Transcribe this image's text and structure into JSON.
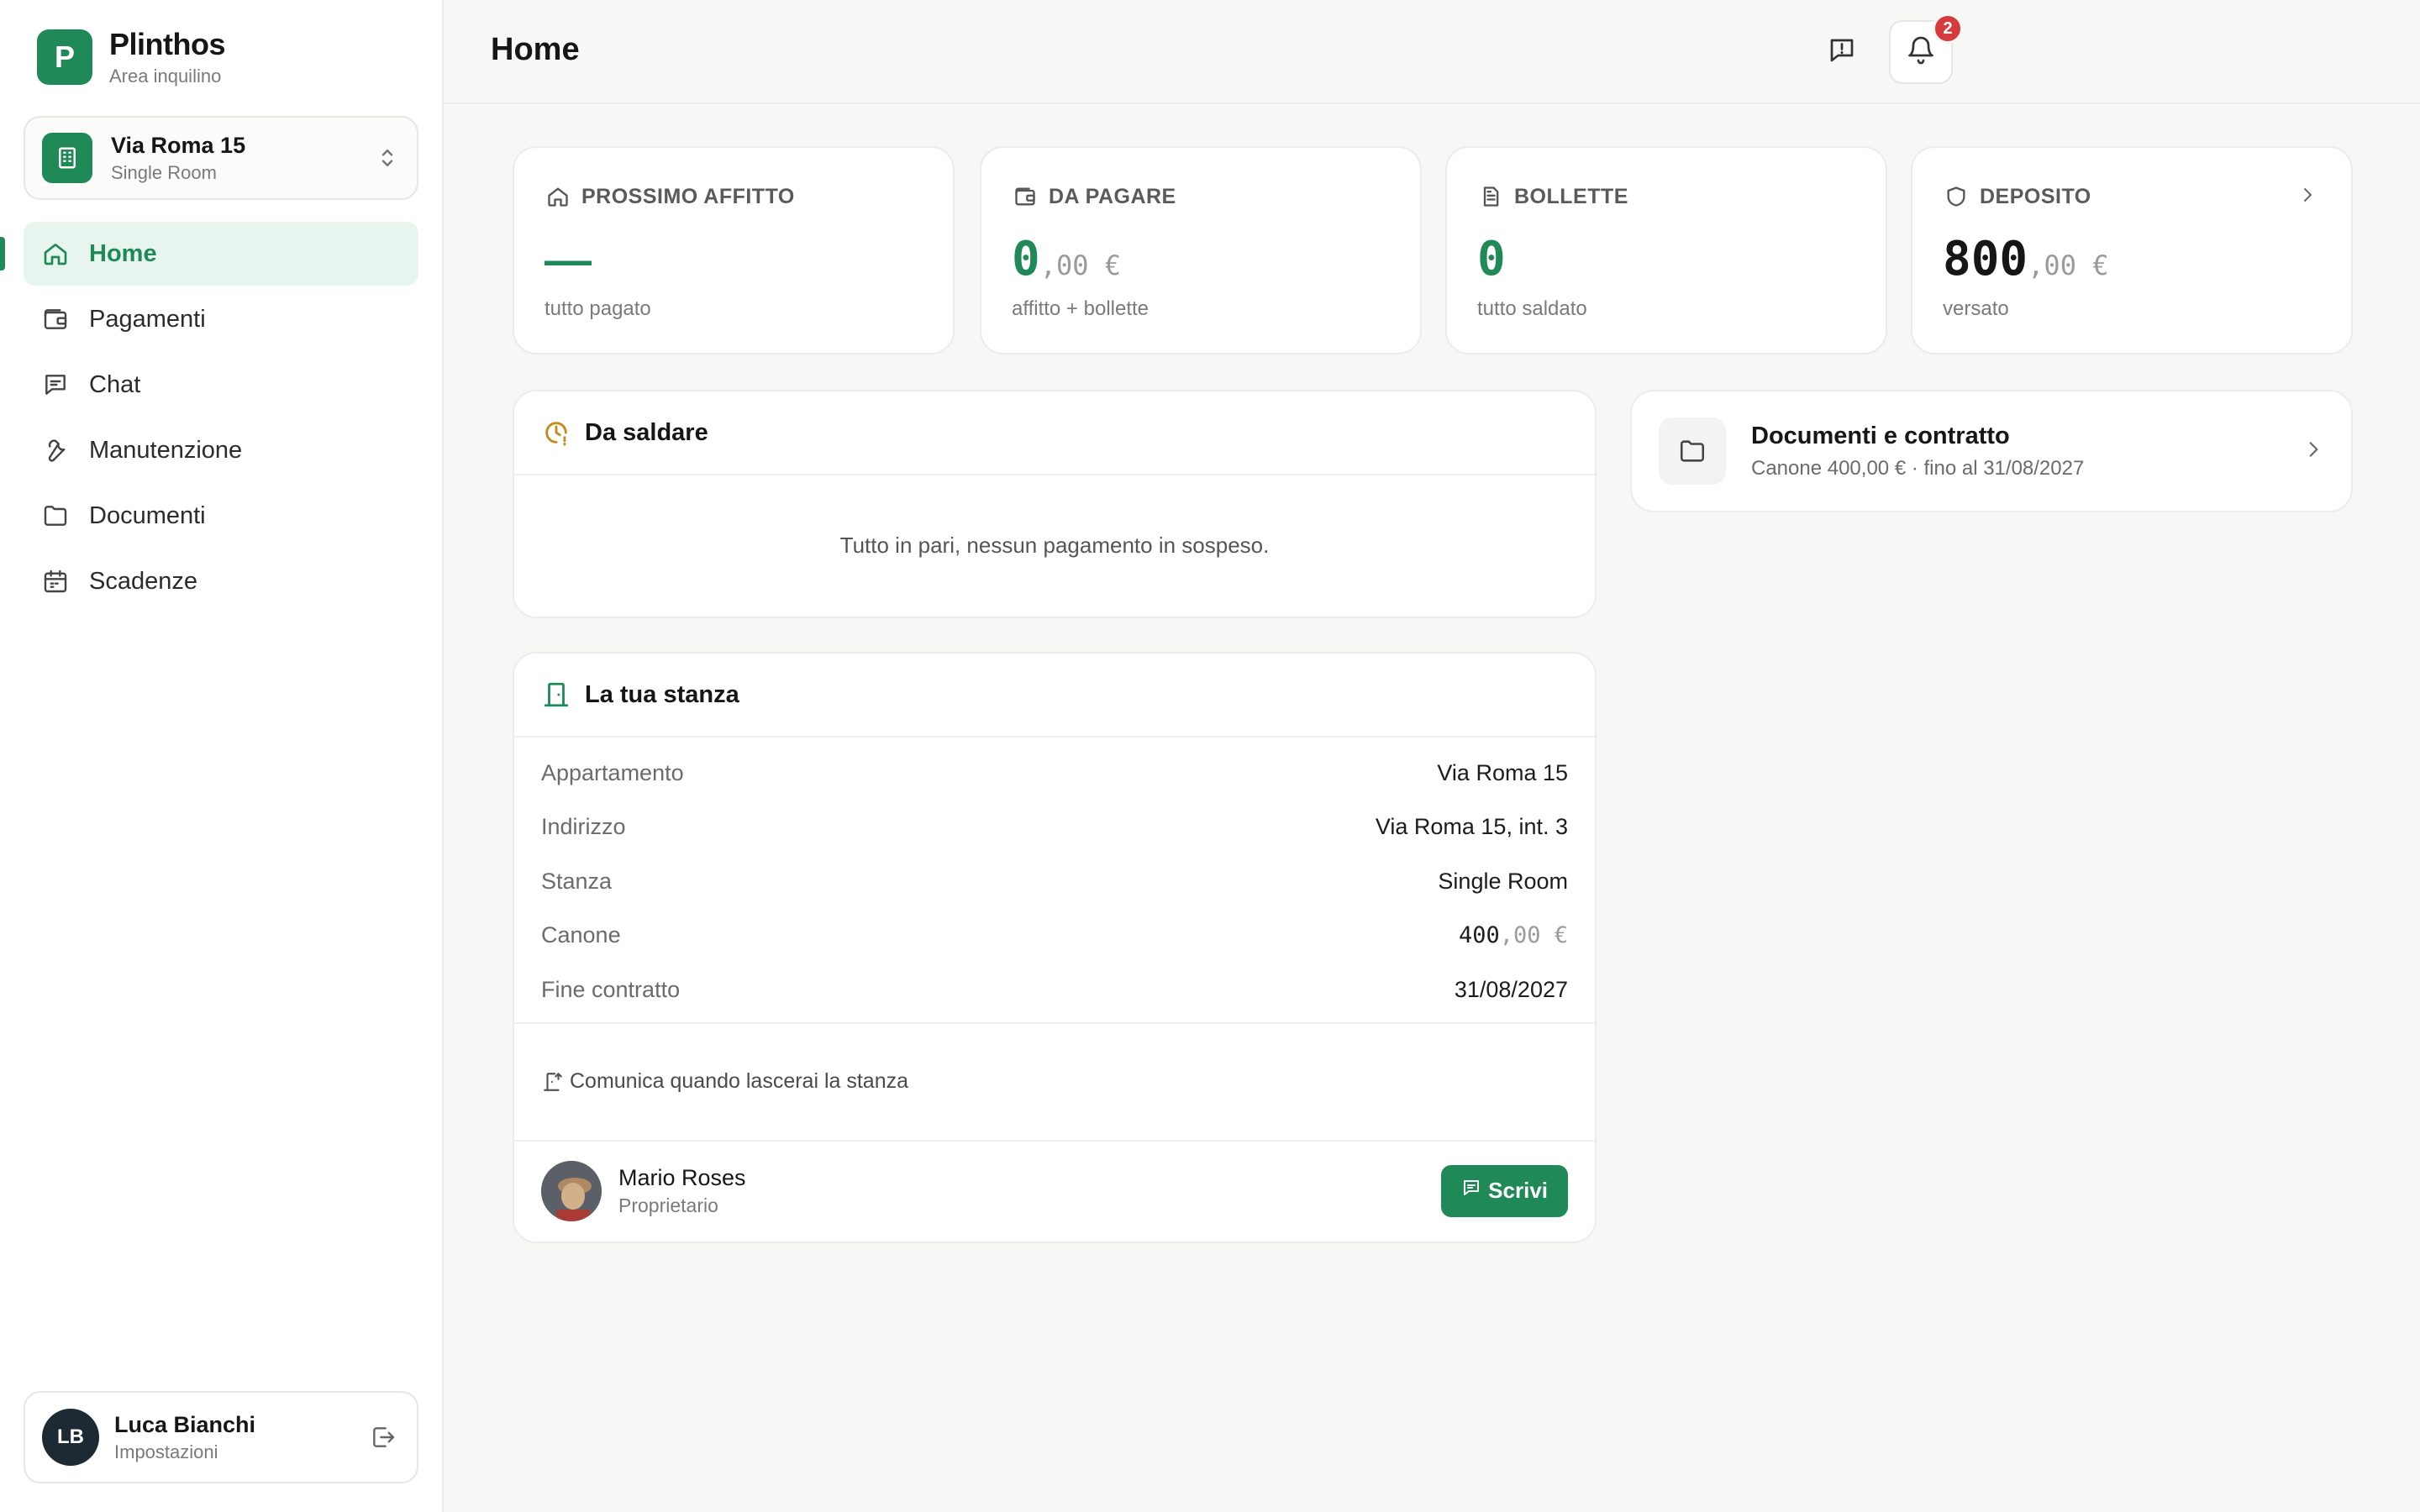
{
  "brand": {
    "logo_letter": "P",
    "name": "Plinthos",
    "subtitle": "Area inquilino"
  },
  "property": {
    "name": "Via Roma 15",
    "room": "Single Room"
  },
  "nav": [
    {
      "label": "Home",
      "icon": "home-icon",
      "active": true
    },
    {
      "label": "Pagamenti",
      "icon": "wallet-icon",
      "active": false
    },
    {
      "label": "Chat",
      "icon": "chat-icon",
      "active": false
    },
    {
      "label": "Manutenzione",
      "icon": "wrench-icon",
      "active": false
    },
    {
      "label": "Documenti",
      "icon": "folder-icon",
      "active": false
    },
    {
      "label": "Scadenze",
      "icon": "calendar-icon",
      "active": false
    }
  ],
  "user": {
    "initials": "LB",
    "name": "Luca Bianchi",
    "subtitle": "Impostazioni"
  },
  "header": {
    "title": "Home",
    "notifications_count": "2"
  },
  "stats": {
    "next_rent": {
      "label": "PROSSIMO AFFITTO",
      "value": "—",
      "sub": "tutto pagato"
    },
    "to_pay": {
      "label": "DA PAGARE",
      "value_int": "0",
      "value_cents": ",00 €",
      "sub": "affitto + bollette"
    },
    "bills": {
      "label": "BOLLETTE",
      "value": "0",
      "sub": "tutto saldato"
    },
    "deposit": {
      "label": "DEPOSITO",
      "value_int": "800",
      "value_cents": ",00 €",
      "sub": "versato"
    }
  },
  "outstanding": {
    "title": "Da saldare",
    "empty_message": "Tutto in pari, nessun pagamento in sospeso."
  },
  "room": {
    "title": "La tua stanza",
    "rows": [
      {
        "label": "Appartamento",
        "value": "Via Roma 15"
      },
      {
        "label": "Indirizzo",
        "value": "Via Roma 15, int. 3"
      },
      {
        "label": "Stanza",
        "value": "Single Room"
      },
      {
        "label": "Canone",
        "value_int": "400",
        "value_cents": ",00 €"
      },
      {
        "label": "Fine contratto",
        "value": "31/08/2027"
      }
    ],
    "leave_link": "Comunica quando lascerai la stanza",
    "owner": {
      "name": "Mario Roses",
      "role": "Proprietario",
      "button": "Scrivi"
    }
  },
  "documents": {
    "title": "Documenti e contratto",
    "subtitle": "Canone 400,00 € · fino al 31/08/2027"
  },
  "colors": {
    "accent": "#1f8a57",
    "badge": "#d63a3a",
    "warning": "#c58a17"
  }
}
